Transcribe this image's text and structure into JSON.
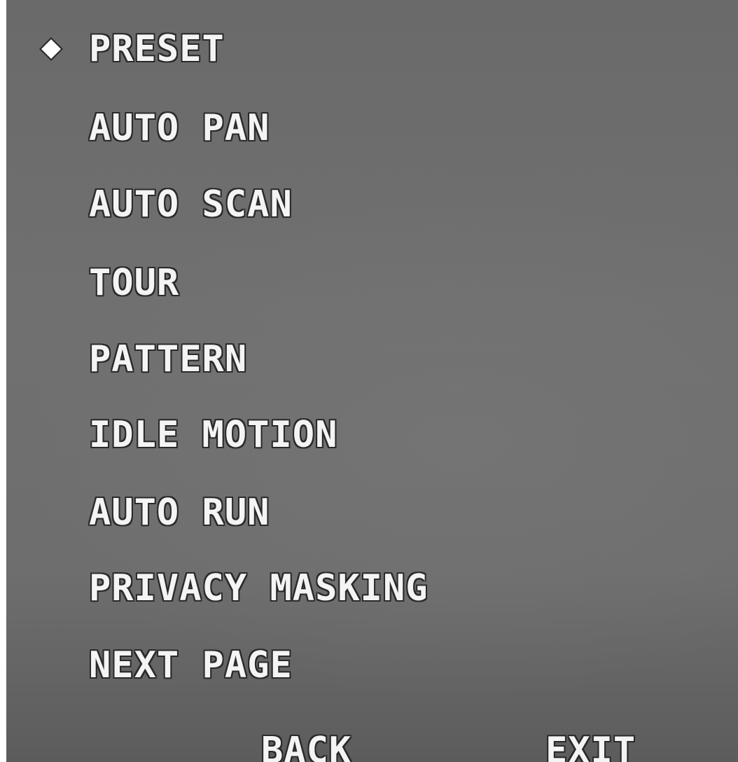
{
  "menu": {
    "selected_index": 0,
    "items": [
      {
        "label": "PRESET"
      },
      {
        "label": "AUTO PAN"
      },
      {
        "label": "AUTO SCAN"
      },
      {
        "label": "TOUR"
      },
      {
        "label": "PATTERN"
      },
      {
        "label": "IDLE MOTION"
      },
      {
        "label": "AUTO RUN"
      },
      {
        "label": "PRIVACY MASKING"
      },
      {
        "label": "NEXT PAGE"
      }
    ]
  },
  "footer": {
    "back_label": "BACK",
    "exit_label": "EXIT"
  },
  "cursor": {
    "icon": "diamond-icon",
    "color": "#ffffff"
  },
  "colors": {
    "text": "#f4f4f4",
    "text_outline": "#2a2a2a",
    "background": "#6a6a6a"
  }
}
